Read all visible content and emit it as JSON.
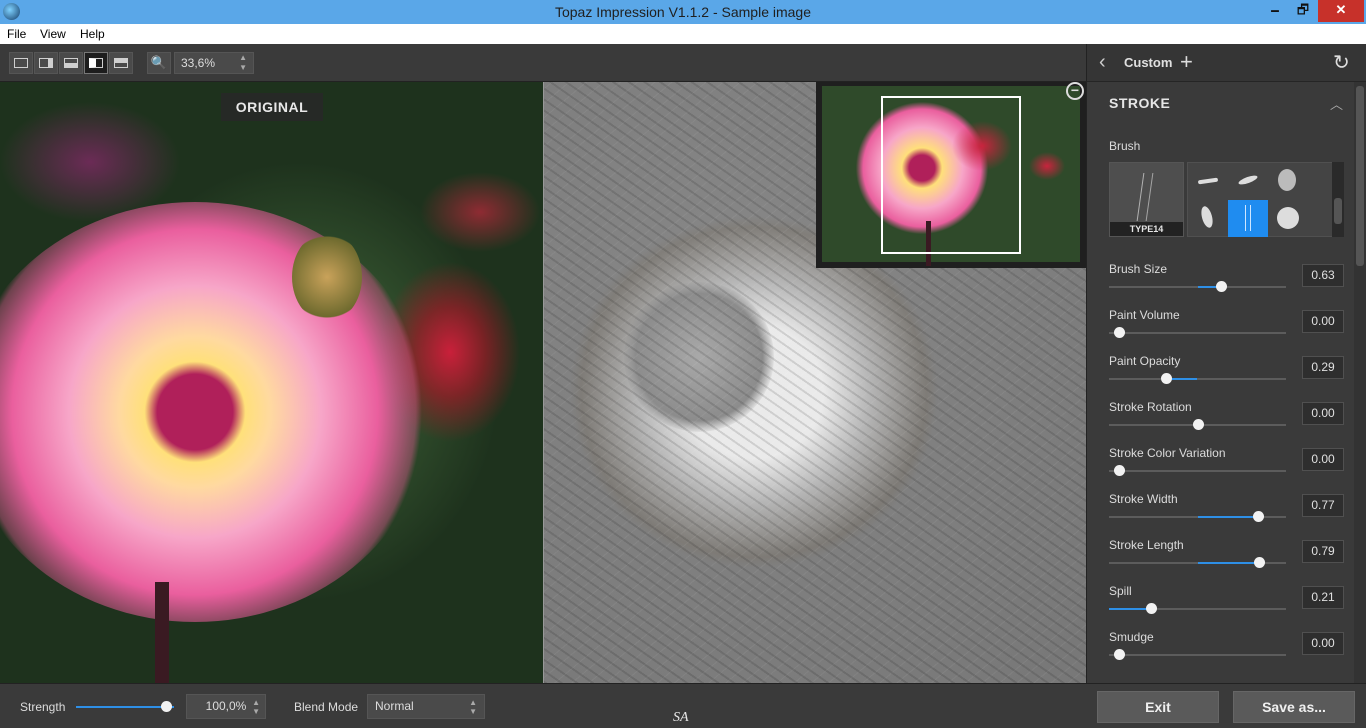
{
  "window": {
    "title": "Topaz Impression V1.1.2 - Sample image",
    "minimize": "🗕",
    "maximize": "🗗",
    "close": "✕"
  },
  "menu": [
    "File",
    "View",
    "Help"
  ],
  "toolbar": {
    "zoom_icon": "🔍",
    "zoom_value": "33,6%",
    "spin": "▲\n▼"
  },
  "canvas": {
    "original_label": "ORIGINAL",
    "collapse_icon": "−"
  },
  "panel": {
    "preset_name": "Custom",
    "back_icon": "‹",
    "add_icon": "+",
    "reset_icon": "↻",
    "section": "STROKE",
    "collapse_icon": "︿",
    "brush_label": "Brush",
    "selected_brush": "TYPE14",
    "sliders": [
      {
        "label": "Brush Size",
        "value": "0.63",
        "level": 0.63,
        "from": 0.5
      },
      {
        "label": "Paint Volume",
        "value": "0.00",
        "level": 0.0,
        "from": 0.0
      },
      {
        "label": "Paint Opacity",
        "value": "0.29",
        "level": 0.32,
        "from": 0.5
      },
      {
        "label": "Stroke Rotation",
        "value": "0.00",
        "level": 0.5,
        "from": 0.5
      },
      {
        "label": "Stroke Color Variation",
        "value": "0.00",
        "level": 0.0,
        "from": 0.0
      },
      {
        "label": "Stroke Width",
        "value": "0.77",
        "level": 0.84,
        "from": 0.5
      },
      {
        "label": "Stroke Length",
        "value": "0.79",
        "level": 0.85,
        "from": 0.5
      },
      {
        "label": "Spill",
        "value": "0.21",
        "level": 0.24,
        "from": 0.0
      },
      {
        "label": "Smudge",
        "value": "0.00",
        "level": 0.0,
        "from": 0.0
      }
    ]
  },
  "bottom": {
    "strength_label": "Strength",
    "strength_value": "100,0%",
    "strength_level": 1.0,
    "blend_label": "Blend Mode",
    "blend_value": "Normal",
    "signature": "SA"
  },
  "actions": {
    "exit": "Exit",
    "save": "Save as..."
  }
}
